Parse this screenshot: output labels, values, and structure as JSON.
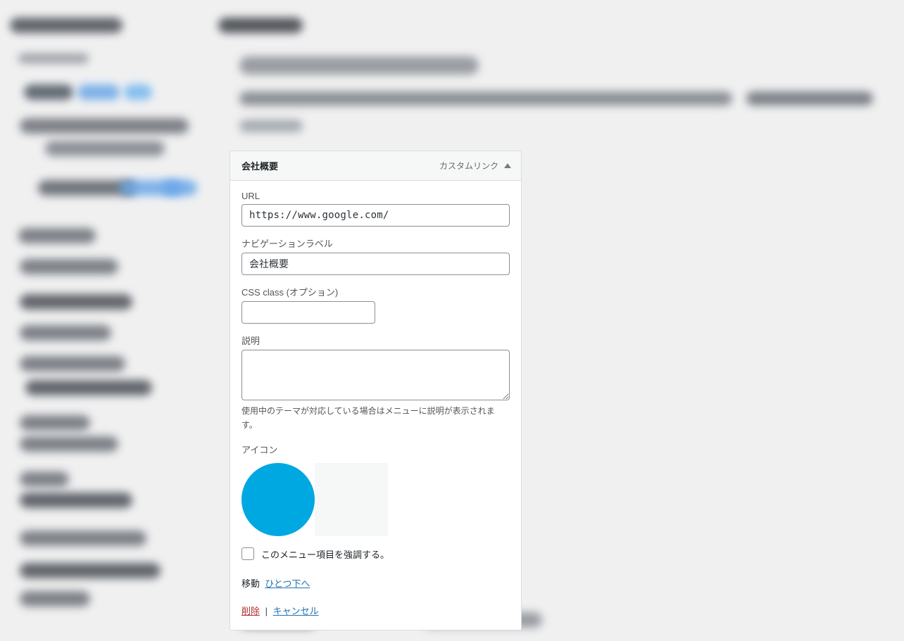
{
  "panel": {
    "title": "会社概要",
    "type": "カスタムリンク",
    "url_label": "URL",
    "url_value": "https://www.google.com/",
    "nav_label": "ナビゲーションラベル",
    "nav_value": "会社概要",
    "css_label": "CSS class (オプション)",
    "css_value": "",
    "desc_label": "説明",
    "desc_value": "",
    "desc_hint": "使用中のテーマが対応している場合はメニューに説明が表示されます。",
    "icon_label": "アイコン",
    "icon_color": "#00a8e1",
    "emph_label": "このメニュー項目を強調する。",
    "move_prefix": "移動",
    "move_down": "ひとつ下へ",
    "delete": "削除",
    "cancel": "キャンセル"
  }
}
